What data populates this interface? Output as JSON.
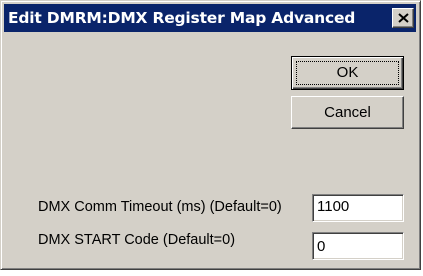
{
  "window": {
    "title": "Edit DMRM:DMX Register Map Advanced",
    "close_icon": "close-icon"
  },
  "buttons": {
    "ok_label": "OK",
    "cancel_label": "Cancel"
  },
  "fields": {
    "timeout": {
      "label": "DMX Comm Timeout (ms) (Default=0)",
      "value": "1100"
    },
    "start_code": {
      "label": "DMX START Code (Default=0)",
      "value": "0"
    }
  },
  "colors": {
    "titlebar": "#0a246a",
    "face": "#d4d0c8",
    "title_text": "#ffffff"
  }
}
